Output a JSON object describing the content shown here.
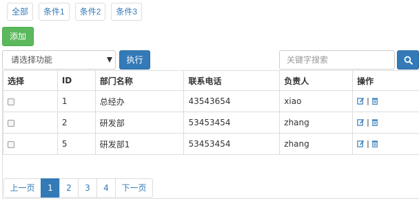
{
  "filters": [
    "全部",
    "条件1",
    "条件2",
    "条件3"
  ],
  "add_label": "添加",
  "func_select": {
    "value": "请选择功能"
  },
  "exec_label": "执行",
  "search": {
    "placeholder": "关键字搜索"
  },
  "table": {
    "headers": [
      "选择",
      "ID",
      "部门名称",
      "联系电话",
      "负责人",
      "操作"
    ],
    "rows": [
      {
        "id": "1",
        "name": "总经办",
        "phone": "43543654",
        "owner": "xiao"
      },
      {
        "id": "2",
        "name": "研发部",
        "phone": "53453454",
        "owner": "zhang"
      },
      {
        "id": "5",
        "name": "研发部1",
        "phone": "53453454",
        "owner": "zhang"
      }
    ],
    "op_separator": "|"
  },
  "pager": {
    "prev": "上一页",
    "pages": [
      "1",
      "2",
      "3",
      "4"
    ],
    "next": "下一页",
    "current": "1"
  },
  "colors": {
    "primary": "#337ab7",
    "success": "#5cb85c"
  }
}
